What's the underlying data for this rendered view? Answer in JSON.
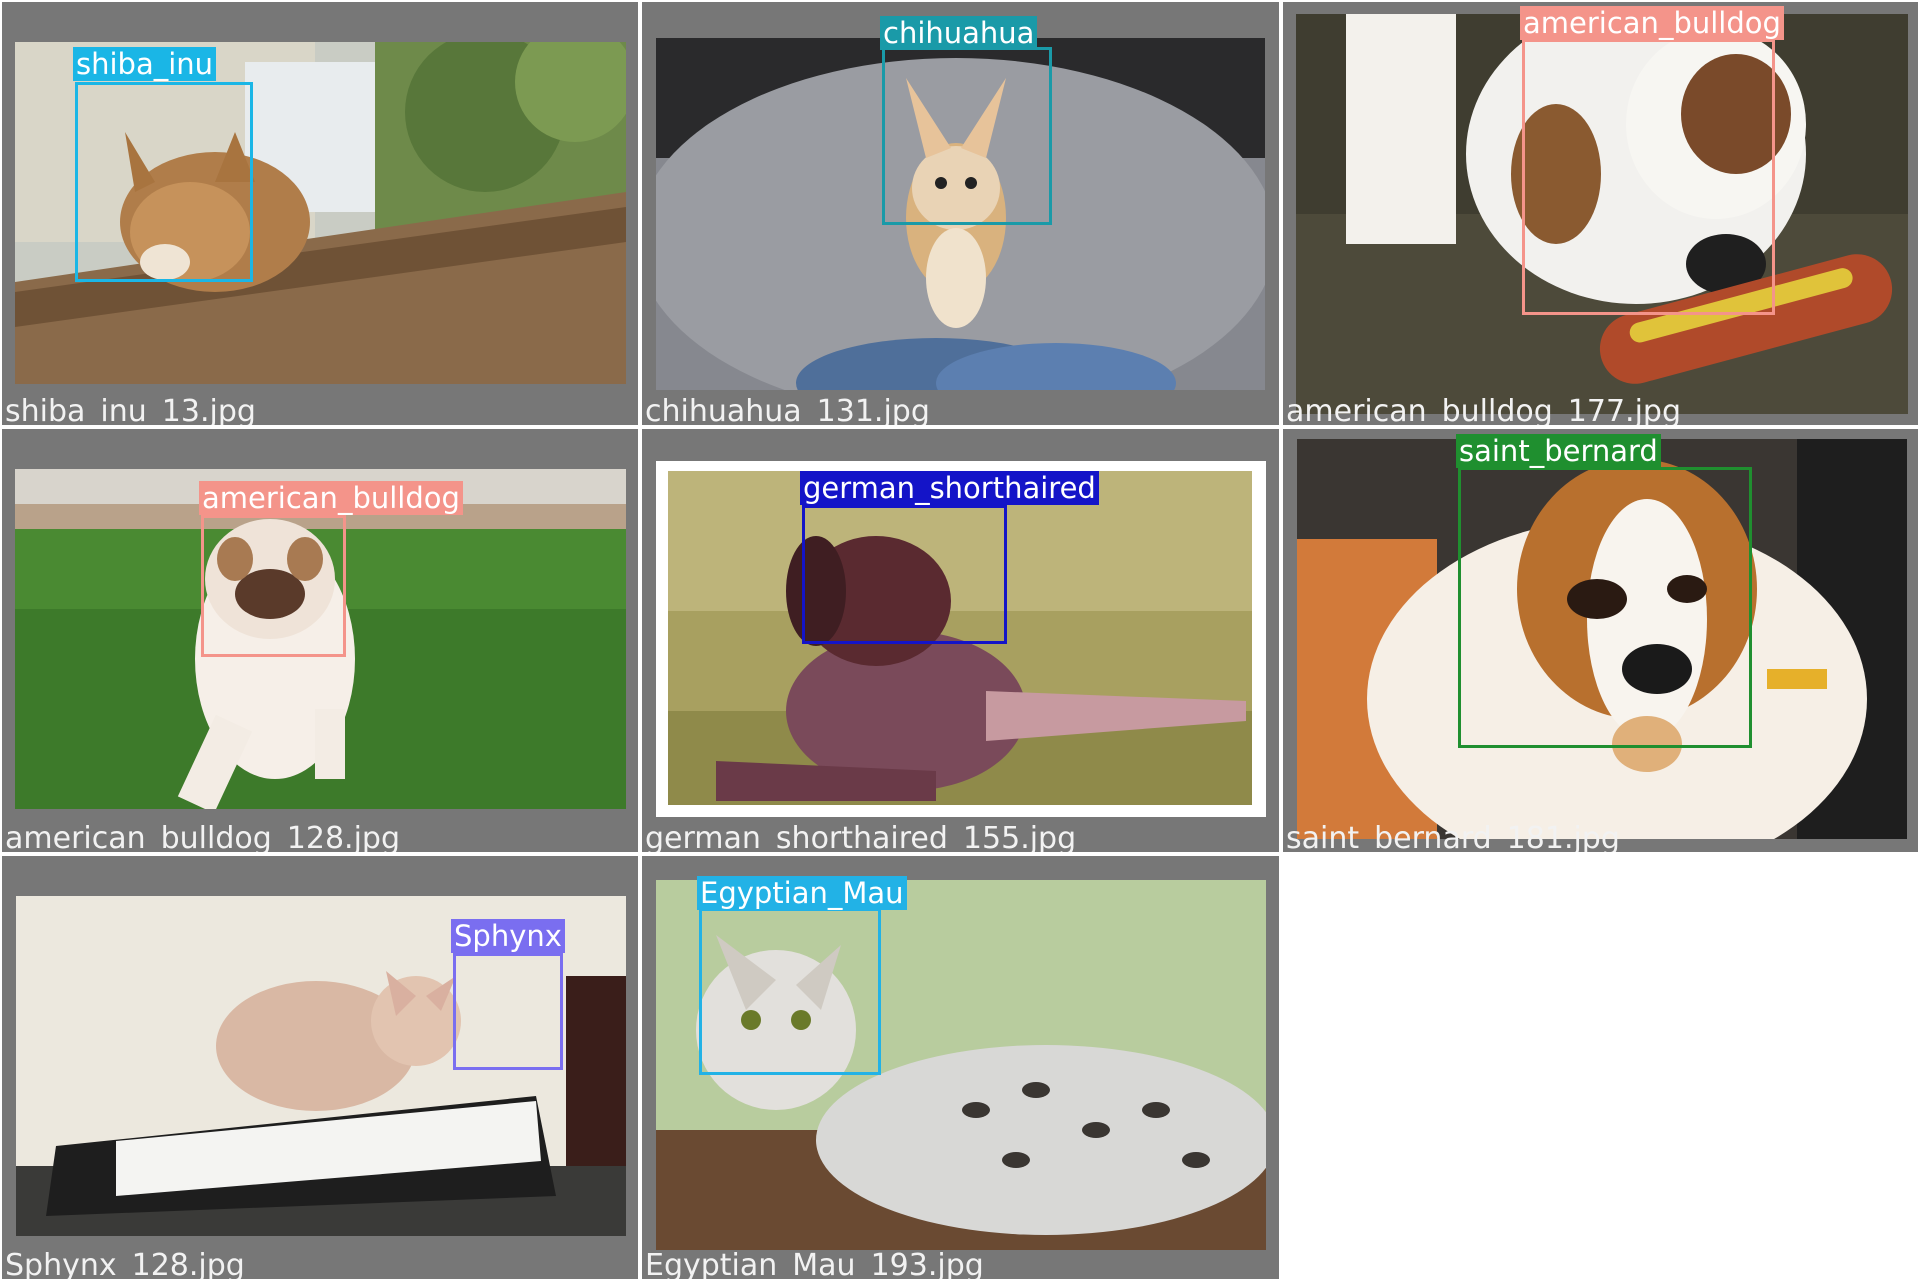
{
  "images": [
    {
      "file": "shiba_inu_13.jpg",
      "label": "shiba_inu",
      "color": "#1ab6e6"
    },
    {
      "file": "chihuahua_131.jpg",
      "label": "chihuahua",
      "color": "#1a9aa8"
    },
    {
      "file": "american_bulldog_177.jpg",
      "label": "american_bulldog",
      "color": "#f4948a"
    },
    {
      "file": "american_bulldog_128.jpg",
      "label": "american_bulldog",
      "color": "#f4948a"
    },
    {
      "file": "german_shorthaired_155.jpg",
      "label": "german_shorthaired",
      "color": "#1414c8"
    },
    {
      "file": "saint_bernard_181.jpg",
      "label": "saint_bernard",
      "color": "#1f8f2f"
    },
    {
      "file": "Sphynx_128.jpg",
      "label": "Sphynx",
      "color": "#7a6ef0"
    },
    {
      "file": "Egyptian_Mau_193.jpg",
      "label": "Egyptian_Mau",
      "color": "#22b2e6"
    }
  ]
}
